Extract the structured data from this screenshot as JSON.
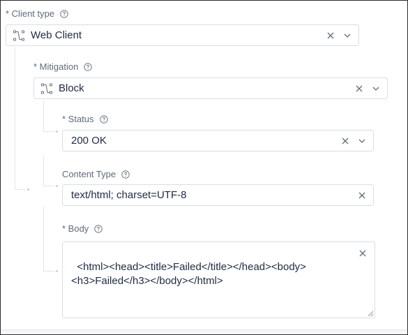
{
  "client_type": {
    "label": "* Client type",
    "value": "Web Client",
    "icon": "route-icon"
  },
  "mitigation": {
    "label": "* Mitigation",
    "value": "Block",
    "icon": "route-icon"
  },
  "status": {
    "label": "* Status",
    "value": "200 OK"
  },
  "content_type": {
    "label": "Content Type",
    "value": "text/html; charset=UTF-8"
  },
  "body_field": {
    "label": "* Body",
    "value": "<html><head><title>Failed</title></head><body>\n<h3>Failed</h3></body></html>"
  },
  "colors": {
    "text": "#1f2a44",
    "label": "#5f6b7a",
    "border": "#d9dde3",
    "tree_line": "#e2e5ea"
  }
}
